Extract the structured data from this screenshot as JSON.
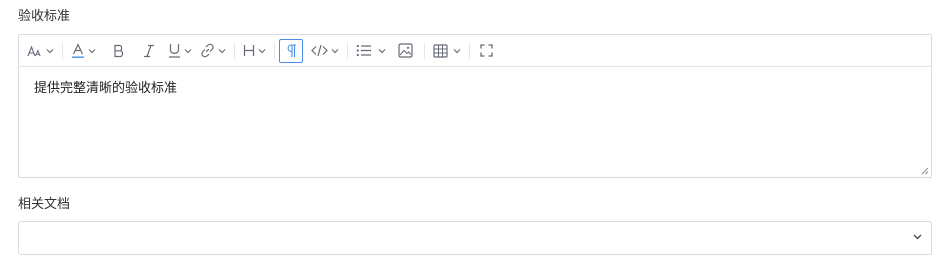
{
  "fields": {
    "acceptance": {
      "label": "验收标准",
      "content": "提供完整清晰的验收标准"
    },
    "related_docs": {
      "label": "相关文档",
      "selected_value": ""
    }
  },
  "toolbar": {
    "items": [
      {
        "name": "font-size-icon",
        "has_dropdown": true
      },
      {
        "name": "font-color-icon",
        "has_dropdown": true
      },
      {
        "name": "bold-icon",
        "has_dropdown": false
      },
      {
        "name": "italic-icon",
        "has_dropdown": false
      },
      {
        "name": "underline-icon",
        "has_dropdown": true
      },
      {
        "name": "link-icon",
        "has_dropdown": true
      },
      {
        "name": "heading-icon",
        "has_dropdown": true
      },
      {
        "name": "paragraph-icon",
        "has_dropdown": false,
        "active": true
      },
      {
        "name": "code-icon",
        "has_dropdown": true
      },
      {
        "name": "list-icon",
        "has_dropdown": true
      },
      {
        "name": "image-icon",
        "has_dropdown": false
      },
      {
        "name": "table-icon",
        "has_dropdown": true
      },
      {
        "name": "fullscreen-icon",
        "has_dropdown": false
      }
    ]
  },
  "colors": {
    "accent": "#4a8de8",
    "border": "#d8dbe2",
    "icon": "#666b75"
  }
}
